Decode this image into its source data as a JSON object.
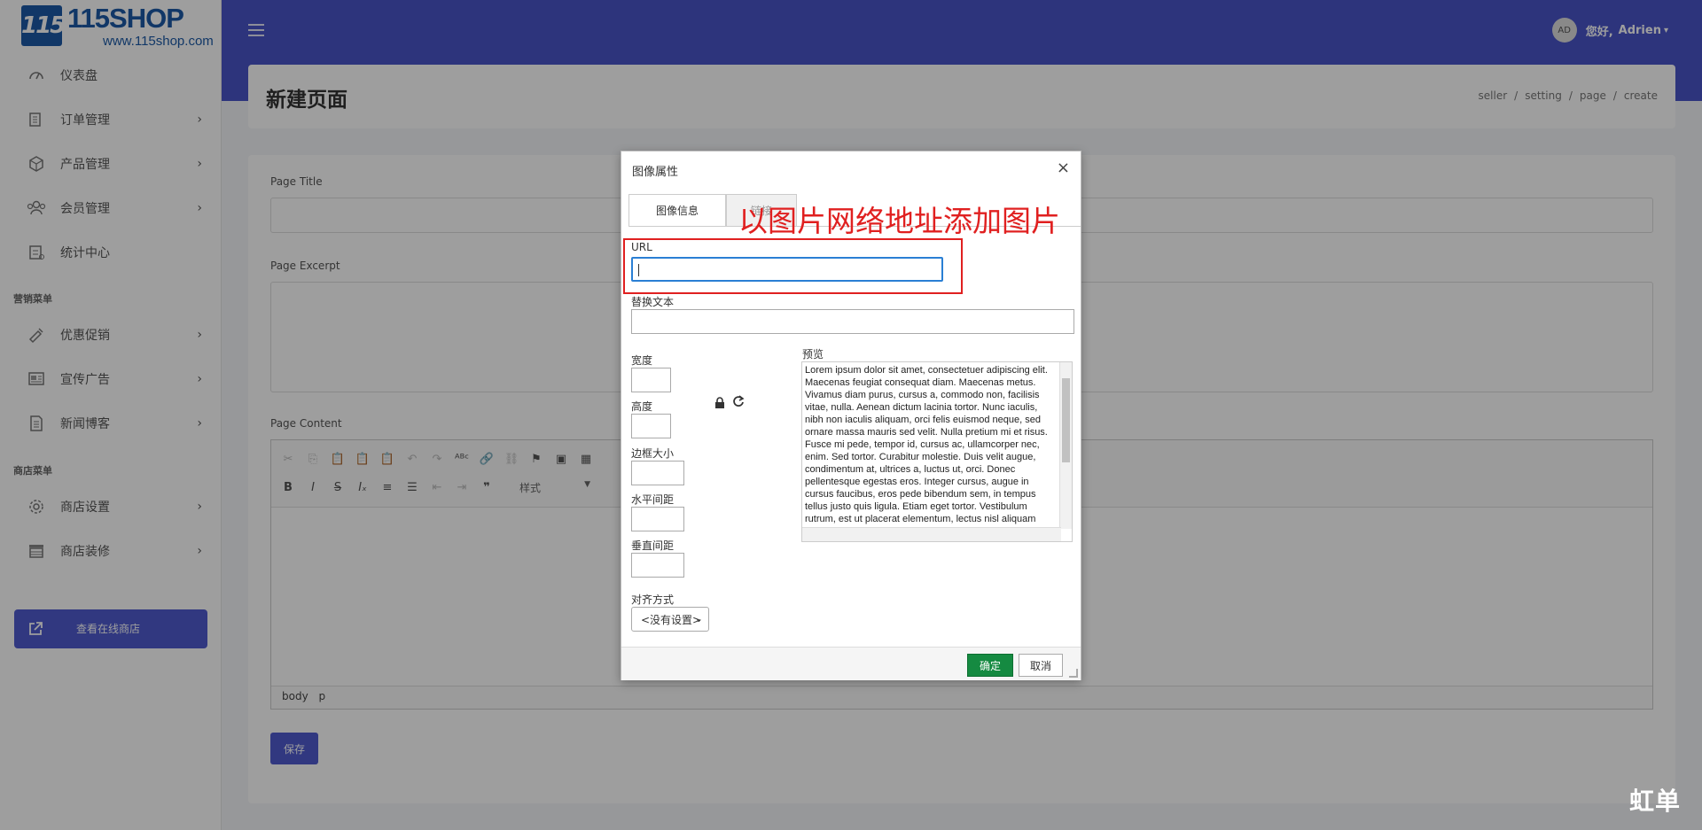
{
  "brand": {
    "name": "115SHOP",
    "url": "www.115shop.com"
  },
  "sidebar": {
    "items": [
      {
        "label": "仪表盘",
        "icon": "dashboard-icon",
        "arrow": ""
      },
      {
        "label": "订单管理",
        "icon": "orders-icon",
        "arrow": "›"
      },
      {
        "label": "产品管理",
        "icon": "product-icon",
        "arrow": "›"
      },
      {
        "label": "会员管理",
        "icon": "members-icon",
        "arrow": "›"
      },
      {
        "label": "统计中心",
        "icon": "stats-icon",
        "arrow": ""
      }
    ],
    "marketing_header": "营销菜单",
    "marketing": [
      {
        "label": "优惠促销",
        "icon": "promo-icon",
        "arrow": "›"
      },
      {
        "label": "宣传广告",
        "icon": "ads-icon",
        "arrow": "›"
      },
      {
        "label": "新闻博客",
        "icon": "news-icon",
        "arrow": "›"
      }
    ],
    "shop_header": "商店菜单",
    "shop": [
      {
        "label": "商店设置",
        "icon": "settings-icon",
        "arrow": "›"
      },
      {
        "label": "商店装修",
        "icon": "decor-icon",
        "arrow": "›"
      }
    ],
    "view_shop": "查看在线商店"
  },
  "topbar": {
    "avatar": "AD",
    "greeting": "您好,",
    "user": "Adrien",
    "caret": "▾"
  },
  "page": {
    "title": "新建页面",
    "breadcrumb": [
      "seller",
      "/",
      "setting",
      "/",
      "page",
      "/",
      "create"
    ]
  },
  "form": {
    "page_title_label": "Page Title",
    "page_excerpt_label": "Page Excerpt",
    "page_content_label": "Page Content",
    "style_label": "样式",
    "path_body": "body",
    "path_p": "p",
    "save": "保存"
  },
  "dialog": {
    "title": "图像属性",
    "close": "×",
    "tab_info": "图像信息",
    "tab_link": "链接",
    "annotation": "以图片网络地址添加图片",
    "url_label": "URL",
    "url_value": "",
    "alt_label": "替换文本",
    "width_label": "宽度",
    "height_label": "高度",
    "border_label": "边框大小",
    "hspace_label": "水平间距",
    "vspace_label": "垂直间距",
    "align_label": "对齐方式",
    "align_value": "<没有设置>",
    "preview_label": "预览",
    "preview_text": "Lorem ipsum dolor sit amet, consectetuer adipiscing elit. Maecenas feugiat consequat diam. Maecenas metus. Vivamus diam purus, cursus a, commodo non, facilisis vitae, nulla. Aenean dictum lacinia tortor. Nunc iaculis, nibh non iaculis aliquam, orci felis euismod neque, sed ornare massa mauris sed velit. Nulla pretium mi et risus. Fusce mi pede, tempor id, cursus ac, ullamcorper nec, enim. Sed tortor. Curabitur molestie. Duis velit augue, condimentum at, ultrices a, luctus ut, orci. Donec pellentesque egestas eros. Integer cursus, augue in cursus faucibus, eros pede bibendum sem, in tempus tellus justo quis ligula. Etiam eget tortor. Vestibulum rutrum, est ut placerat elementum, lectus nisl aliquam velit, tempor aliquam eros nunc nonummy metus.",
    "ok": "确定",
    "cancel": "取消"
  },
  "watermark": "虹单",
  "colors": {
    "topbar": "#4a55c8",
    "primary": "#4f5bcf",
    "ok": "#158a41",
    "annotation": "#e02020",
    "logo": "#1c5aa6"
  }
}
